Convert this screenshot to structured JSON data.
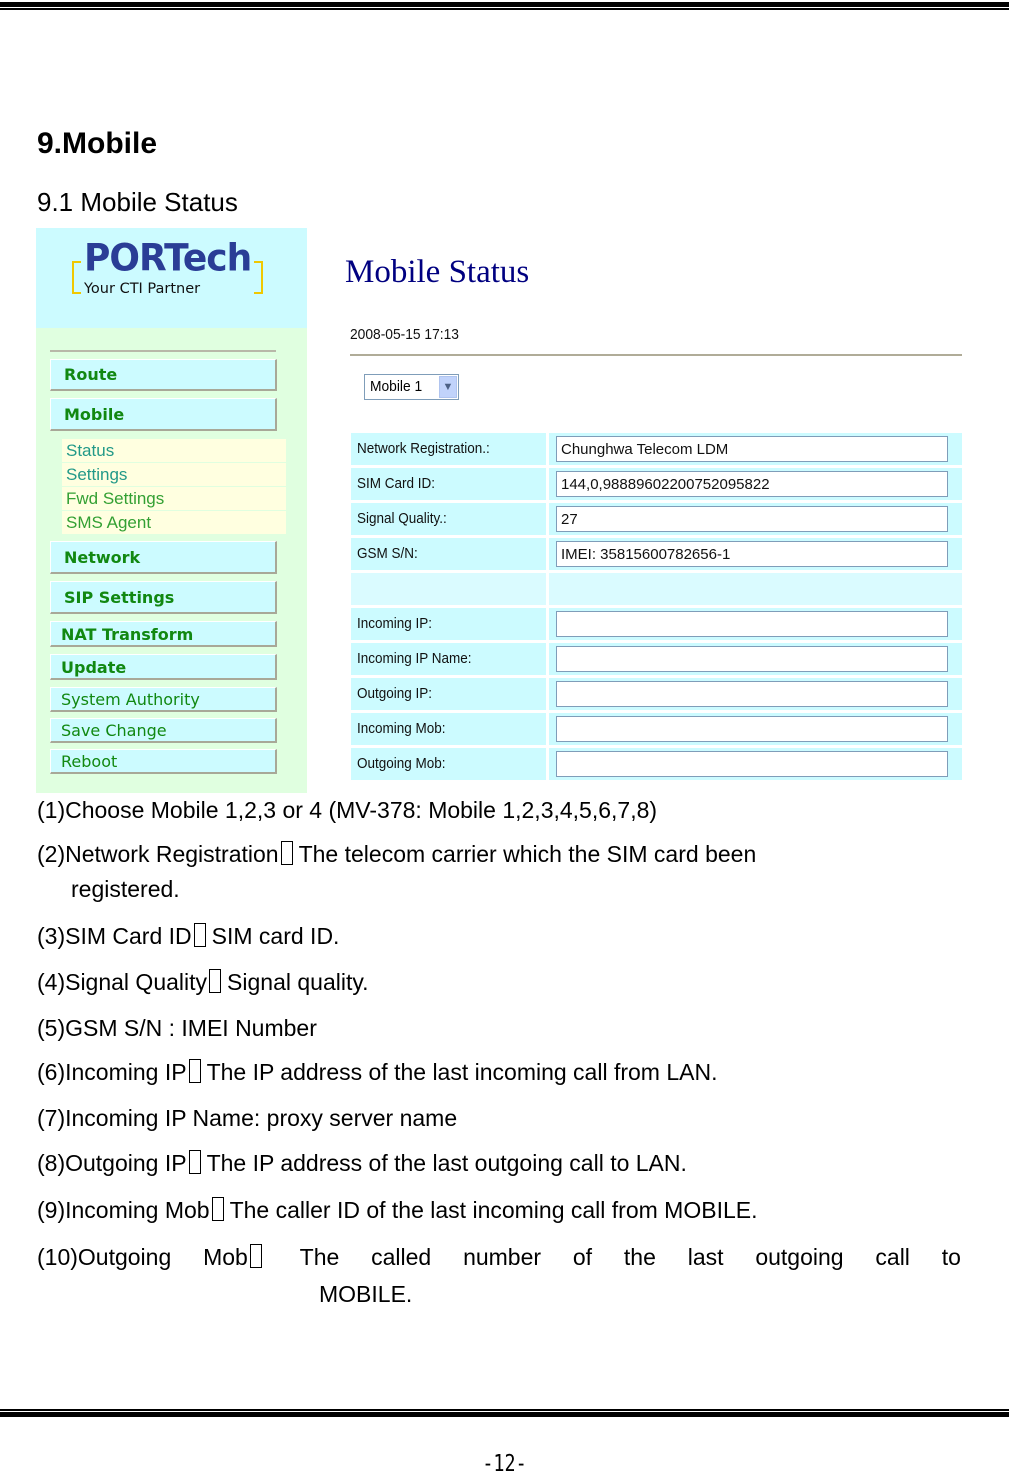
{
  "document": {
    "section_title": "9.Mobile",
    "subsection_title": "9.1 Mobile Status",
    "page_number": "-12-"
  },
  "screenshot": {
    "logo": {
      "brand": "PORTech",
      "tagline": "Your CTI Partner"
    },
    "sidebar": {
      "nav": [
        {
          "label": "Route",
          "bold": true
        },
        {
          "label": "Mobile",
          "bold": true
        },
        {
          "label": "Network",
          "bold": true
        },
        {
          "label": "SIP Settings",
          "bold": true
        },
        {
          "label": "NAT Transform",
          "bold": true
        },
        {
          "label": "Update",
          "bold": true
        },
        {
          "label": "System Authority",
          "bold": false
        },
        {
          "label": "Save Change",
          "bold": false
        },
        {
          "label": "Reboot",
          "bold": false
        }
      ],
      "mobile_submenu": [
        {
          "label": "Status"
        },
        {
          "label": "Settings"
        },
        {
          "label": "Fwd Settings"
        },
        {
          "label": "SMS Agent"
        }
      ]
    },
    "main": {
      "title": "Mobile Status",
      "datetime": "2008-05-15 17:13",
      "mobile_select": {
        "selected": "Mobile 1"
      },
      "fields": [
        {
          "label": "Network Registration.:",
          "value": "Chunghwa Telecom LDM"
        },
        {
          "label": "SIM Card ID:",
          "value": "144,0,98889602200752095822"
        },
        {
          "label": "Signal Quality.:",
          "value": "27"
        },
        {
          "label": "GSM S/N:",
          "value": "IMEI: 35815600782656-1"
        },
        {
          "label": "Incoming IP:",
          "value": ""
        },
        {
          "label": "Incoming IP Name:",
          "value": ""
        },
        {
          "label": "Outgoing IP:",
          "value": ""
        },
        {
          "label": "Incoming Mob:",
          "value": ""
        },
        {
          "label": "Outgoing Mob:",
          "value": ""
        }
      ]
    }
  },
  "descriptions": {
    "d1": "(1)Choose Mobile 1,2,3 or 4  (MV-378: Mobile 1,2,3,4,5,6,7,8)",
    "d2_term": "(2)Network Registration",
    "d2_text": "The telecom carrier which the SIM card been",
    "d2_cont": "registered.",
    "d3_term": "(3)SIM Card ID",
    "d3_text": "SIM  card ID.",
    "d4_term": "(4)Signal Quality",
    "d4_text": "Signal quality.",
    "d5": "(5)GSM S/N : IMEI Number",
    "d6_term": "(6)Incoming IP",
    "d6_text": "The IP address of the last incoming call from LAN.",
    "d7": "(7)Incoming IP Name: proxy server name",
    "d8_term": "(8)Outgoing IP",
    "d8_text": "The IP address of the last outgoing call to LAN.",
    "d9_term": "(9)Incoming Mob",
    "d9_text": "The caller ID of the last incoming call from MOBILE.",
    "d10_words": [
      "(10)Outgoing",
      "Mob",
      "The",
      "called",
      "number",
      "of",
      "the",
      "last",
      "outgoing",
      "call",
      "to"
    ],
    "d10_cont": "MOBILE."
  }
}
